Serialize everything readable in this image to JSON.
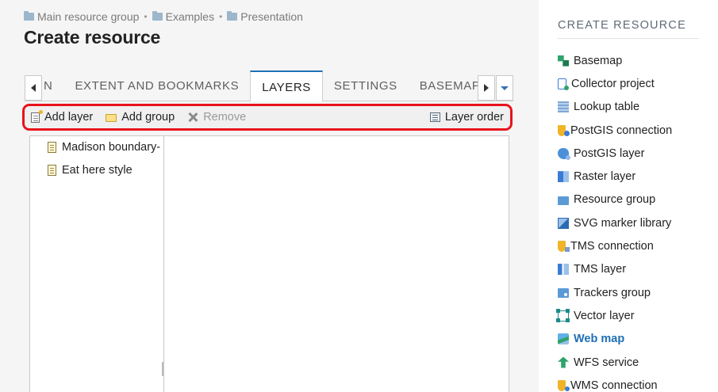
{
  "breadcrumb": {
    "items": [
      "Main resource group",
      "Examples",
      "Presentation"
    ],
    "separator": "•"
  },
  "page": {
    "title": "Create resource"
  },
  "tabs": {
    "items": [
      "N",
      "EXTENT AND BOOKMARKS",
      "LAYERS",
      "SETTINGS",
      "BASEMAPS"
    ],
    "active": "LAYERS"
  },
  "toolbar": {
    "add_layer": "Add layer",
    "add_group": "Add group",
    "remove": "Remove",
    "layer_order": "Layer order"
  },
  "layers_tree": {
    "items": [
      "Madison boundary-",
      "Eat here style"
    ]
  },
  "sidebar": {
    "title": "CREATE RESOURCE",
    "active_item": "Web map",
    "items": [
      {
        "label": "Basemap",
        "icon": "basemap-icon"
      },
      {
        "label": "Collector project",
        "icon": "collector-project-icon"
      },
      {
        "label": "Lookup table",
        "icon": "lookup-table-icon"
      },
      {
        "label": "PostGIS connection",
        "icon": "postgis-connection-icon"
      },
      {
        "label": "PostGIS layer",
        "icon": "postgis-layer-icon"
      },
      {
        "label": "Raster layer",
        "icon": "raster-layer-icon"
      },
      {
        "label": "Resource group",
        "icon": "resource-group-icon"
      },
      {
        "label": "SVG marker library",
        "icon": "svg-marker-library-icon"
      },
      {
        "label": "TMS connection",
        "icon": "tms-connection-icon"
      },
      {
        "label": "TMS layer",
        "icon": "tms-layer-icon"
      },
      {
        "label": "Trackers group",
        "icon": "trackers-group-icon"
      },
      {
        "label": "Vector layer",
        "icon": "vector-layer-icon"
      },
      {
        "label": "Web map",
        "icon": "web-map-icon"
      },
      {
        "label": "WFS service",
        "icon": "wfs-service-icon"
      },
      {
        "label": "WMS connection",
        "icon": "wms-connection-icon"
      }
    ]
  },
  "colors": {
    "accent": "#1f6fb5",
    "highlight_outline": "#e8131b",
    "main_background": "#f5f5f5"
  }
}
